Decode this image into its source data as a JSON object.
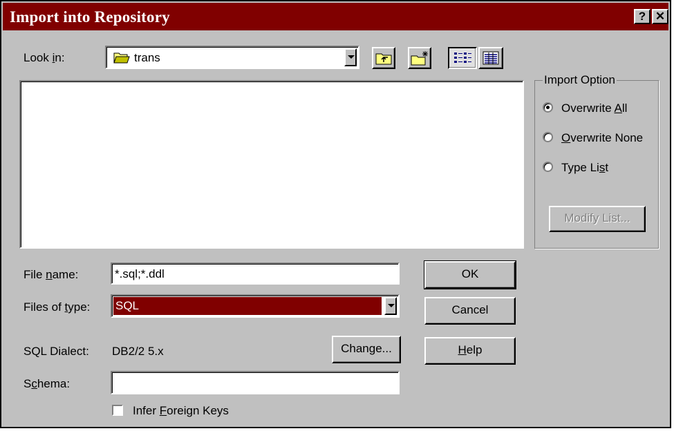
{
  "window": {
    "title": "Import into Repository",
    "help_glyph": "?",
    "close_glyph": "✕"
  },
  "lookin": {
    "label_pre": "Look ",
    "label_key": "i",
    "label_post": "n:",
    "value": "trans"
  },
  "toolbar": {
    "up_icon": "up-one-level-icon",
    "new_folder_icon": "new-folder-icon",
    "list_icon": "list-view-icon",
    "details_icon": "details-view-icon"
  },
  "import_option": {
    "title": "Import Option",
    "options": [
      {
        "pre": "Overwrite ",
        "key": "A",
        "post": "ll",
        "selected": true
      },
      {
        "pre": "",
        "key": "O",
        "post": "verwrite None",
        "selected": false
      },
      {
        "pre": "Type Li",
        "key": "s",
        "post": "t",
        "selected": false
      }
    ],
    "modify_list": "Modify List..."
  },
  "filename": {
    "label_pre": "File ",
    "label_key": "n",
    "label_post": "ame:",
    "value": "*.sql;*.ddl"
  },
  "filetype": {
    "label_pre": "Files of ",
    "label_key": "t",
    "label_post": "ype:",
    "value": "SQL"
  },
  "dialect": {
    "label": "SQL Dialect:",
    "value": "DB2/2 5.x",
    "change_button": "Change..."
  },
  "schema": {
    "label_pre": "S",
    "label_key": "c",
    "label_post": "hema:",
    "value": ""
  },
  "infer": {
    "pre": "Infer ",
    "key": "F",
    "post": "oreign Keys",
    "checked": false
  },
  "buttons": {
    "ok": "OK",
    "cancel": "Cancel",
    "help_key": "H",
    "help_post": "elp"
  },
  "colors": {
    "titlebar": "#800000",
    "face": "#c0c0c0",
    "selection": "#800000"
  }
}
